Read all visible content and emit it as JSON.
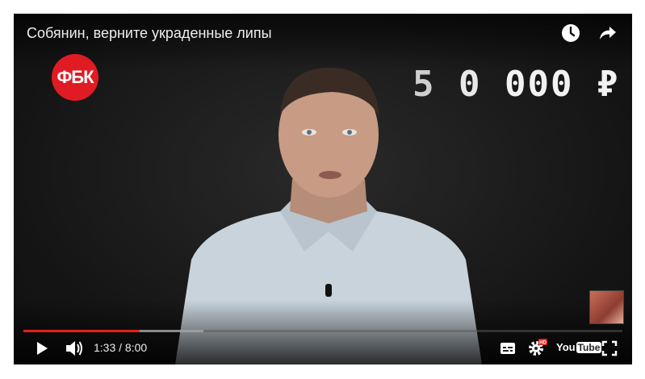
{
  "video": {
    "title": "Собянин, верните украденные липы",
    "logo_text": "ФБК",
    "overlay_amount": {
      "digit1": "5",
      "digit2": "0",
      "rest": "000 ₽"
    }
  },
  "player": {
    "current_time": "1:33",
    "duration": "8:00",
    "time_display": "1:33 / 8:00",
    "progress_fraction": 0.194,
    "buffer_fraction": 0.3,
    "youtube_logo_you": "You",
    "youtube_logo_tube": "Tube",
    "hd_badge": "HD"
  },
  "icons": {
    "watch_later": "clock-icon",
    "share": "share-icon",
    "play": "play-icon",
    "volume": "volume-icon",
    "subtitles": "subtitles-icon",
    "settings": "gear-icon",
    "fullscreen": "fullscreen-icon"
  },
  "colors": {
    "progress": "#e62117",
    "logo_bg": "#e01b24"
  }
}
